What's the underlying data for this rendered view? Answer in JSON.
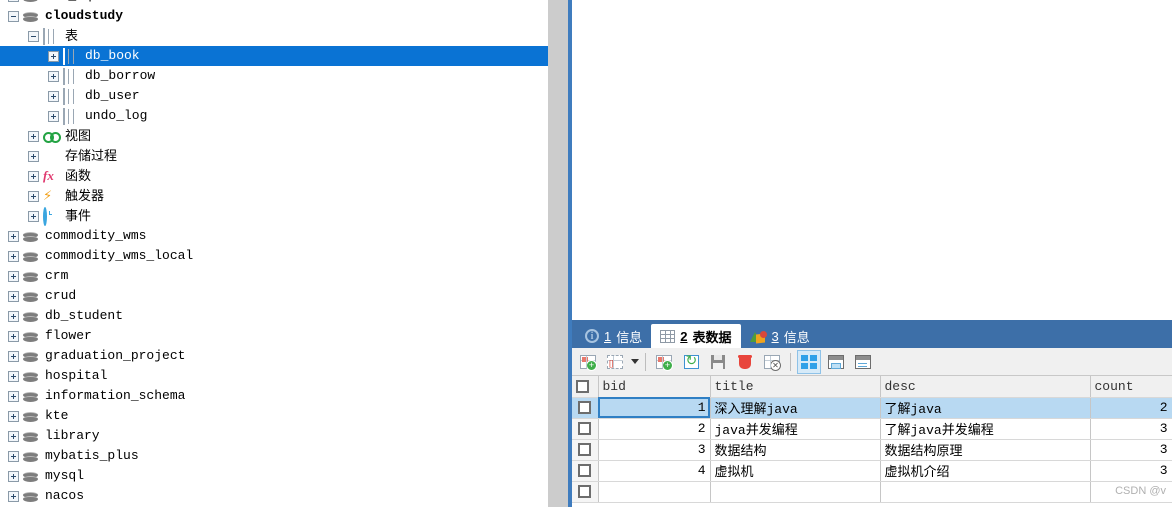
{
  "tree": {
    "rows": [
      {
        "indent": 0,
        "expander": "plus",
        "icon": "db-icon",
        "label": "crm_sql",
        "clipped": true,
        "bold": false,
        "selected": false
      },
      {
        "indent": 0,
        "expander": "minus",
        "icon": "db-icon",
        "label": "cloudstudy",
        "bold": true,
        "selected": false
      },
      {
        "indent": 1,
        "expander": "minus",
        "icon": "table-icon",
        "label": "表",
        "cjk": true,
        "selected": false
      },
      {
        "indent": 2,
        "expander": "plus",
        "icon": "table-icon",
        "label": "db_book",
        "selected": true
      },
      {
        "indent": 2,
        "expander": "plus",
        "icon": "table-icon",
        "label": "db_borrow",
        "selected": false
      },
      {
        "indent": 2,
        "expander": "plus",
        "icon": "table-icon",
        "label": "db_user",
        "selected": false
      },
      {
        "indent": 2,
        "expander": "plus",
        "icon": "table-icon",
        "label": "undo_log",
        "selected": false
      },
      {
        "indent": 1,
        "expander": "plus",
        "icon": "view-icon",
        "label": "视图",
        "cjk": true,
        "selected": false
      },
      {
        "indent": 1,
        "expander": "plus",
        "icon": "gear-icon",
        "label": "存储过程",
        "cjk": true,
        "selected": false
      },
      {
        "indent": 1,
        "expander": "plus",
        "icon": "function-icon",
        "label": "函数",
        "cjk": true,
        "selected": false
      },
      {
        "indent": 1,
        "expander": "plus",
        "icon": "trigger-icon",
        "label": "触发器",
        "cjk": true,
        "selected": false
      },
      {
        "indent": 1,
        "expander": "plus",
        "icon": "event-icon",
        "label": "事件",
        "cjk": true,
        "selected": false
      },
      {
        "indent": 0,
        "expander": "plus",
        "icon": "db-icon",
        "label": "commodity_wms",
        "selected": false
      },
      {
        "indent": 0,
        "expander": "plus",
        "icon": "db-icon",
        "label": "commodity_wms_local",
        "selected": false
      },
      {
        "indent": 0,
        "expander": "plus",
        "icon": "db-icon",
        "label": "crm",
        "selected": false
      },
      {
        "indent": 0,
        "expander": "plus",
        "icon": "db-icon",
        "label": "crud",
        "selected": false
      },
      {
        "indent": 0,
        "expander": "plus",
        "icon": "db-icon",
        "label": "db_student",
        "selected": false
      },
      {
        "indent": 0,
        "expander": "plus",
        "icon": "db-icon",
        "label": "flower",
        "selected": false
      },
      {
        "indent": 0,
        "expander": "plus",
        "icon": "db-icon",
        "label": "graduation_project",
        "selected": false
      },
      {
        "indent": 0,
        "expander": "plus",
        "icon": "db-icon",
        "label": "hospital",
        "selected": false
      },
      {
        "indent": 0,
        "expander": "plus",
        "icon": "db-icon",
        "label": "information_schema",
        "selected": false
      },
      {
        "indent": 0,
        "expander": "plus",
        "icon": "db-icon",
        "label": "kte",
        "selected": false
      },
      {
        "indent": 0,
        "expander": "plus",
        "icon": "db-icon",
        "label": "library",
        "selected": false
      },
      {
        "indent": 0,
        "expander": "plus",
        "icon": "db-icon",
        "label": "mybatis_plus",
        "selected": false
      },
      {
        "indent": 0,
        "expander": "plus",
        "icon": "db-icon",
        "label": "mysql",
        "selected": false
      },
      {
        "indent": 0,
        "expander": "plus",
        "icon": "db-icon",
        "label": "nacos",
        "selected": false
      }
    ]
  },
  "results": {
    "tabs": [
      {
        "num": "1",
        "label": "信息",
        "icon": "info-icon",
        "active": false
      },
      {
        "num": "2",
        "label": "表数据",
        "icon": "grid-icon",
        "active": true
      },
      {
        "num": "3",
        "label": "信息",
        "icon": "chart-icon",
        "active": false
      }
    ],
    "toolbar": [
      {
        "name": "add-record-button",
        "icon": "add-record-icon"
      },
      {
        "name": "delete-record-button",
        "icon": "delete-record-icon",
        "dropdown": true
      },
      {
        "name": "add-field-button",
        "icon": "add-field-icon"
      },
      {
        "name": "refresh-button",
        "icon": "refresh-icon"
      },
      {
        "name": "save-button",
        "icon": "save-icon"
      },
      {
        "name": "delete-button",
        "icon": "trash-icon"
      },
      {
        "name": "cancel-button",
        "icon": "cancel-icon"
      },
      {
        "name": "grid-view-button",
        "icon": "grid-view-icon",
        "active": true
      },
      {
        "name": "form-view-button",
        "icon": "form-view-icon"
      },
      {
        "name": "text-view-button",
        "icon": "text-view-icon"
      }
    ],
    "grid": {
      "columns": [
        "bid",
        "title",
        "desc",
        "count"
      ],
      "active_column": "bid",
      "rows": [
        {
          "bid": "1",
          "title": "深入理解java",
          "desc": "了解java",
          "count": "2",
          "selected": true
        },
        {
          "bid": "2",
          "title": "java并发编程",
          "desc": "了解java并发编程",
          "count": "3",
          "selected": false
        },
        {
          "bid": "3",
          "title": "数据结构",
          "desc": "数据结构原理",
          "count": "3",
          "selected": false
        },
        {
          "bid": "4",
          "title": "虚拟机",
          "desc": "虚拟机介绍",
          "count": "3",
          "selected": false
        },
        {
          "bid": "",
          "title": "",
          "desc": "",
          "count": "",
          "selected": false
        }
      ]
    }
  },
  "watermark": "CSDN @v"
}
